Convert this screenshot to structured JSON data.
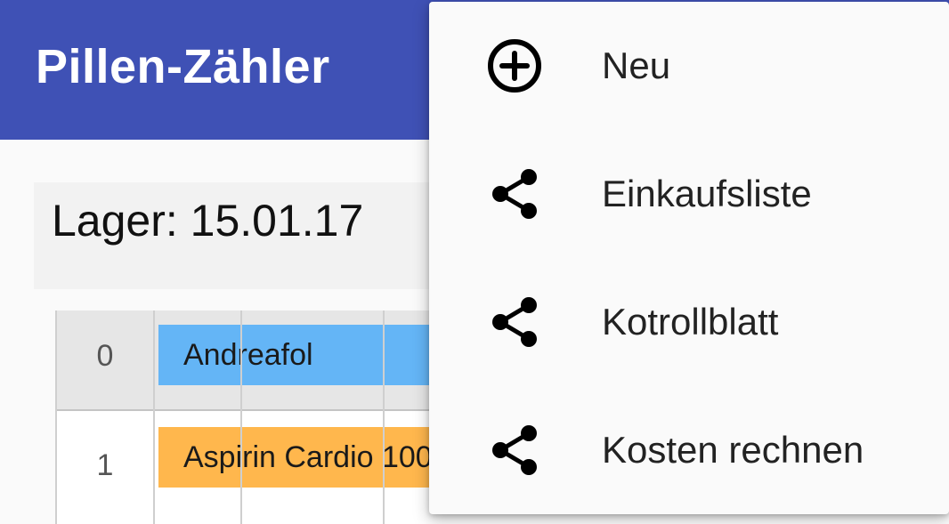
{
  "app": {
    "title": "Pillen-Zähler"
  },
  "storage": {
    "label": "Lager: 15.01.17"
  },
  "table": {
    "rows": [
      {
        "index": "0",
        "name": "Andreafol",
        "color": "#64b5f6"
      },
      {
        "index": "1",
        "name": "Aspirin Cardio 100",
        "color": "#ffb74d"
      }
    ]
  },
  "menu": {
    "items": [
      {
        "label": "Neu",
        "icon": "add-circle-icon"
      },
      {
        "label": "Einkaufsliste",
        "icon": "share-icon"
      },
      {
        "label": "Kotrollblatt",
        "icon": "share-icon"
      },
      {
        "label": "Kosten rechnen",
        "icon": "share-icon"
      }
    ]
  },
  "colors": {
    "appbar": "#3f51b5",
    "background": "#fafafa",
    "menu": "#fafafa"
  }
}
